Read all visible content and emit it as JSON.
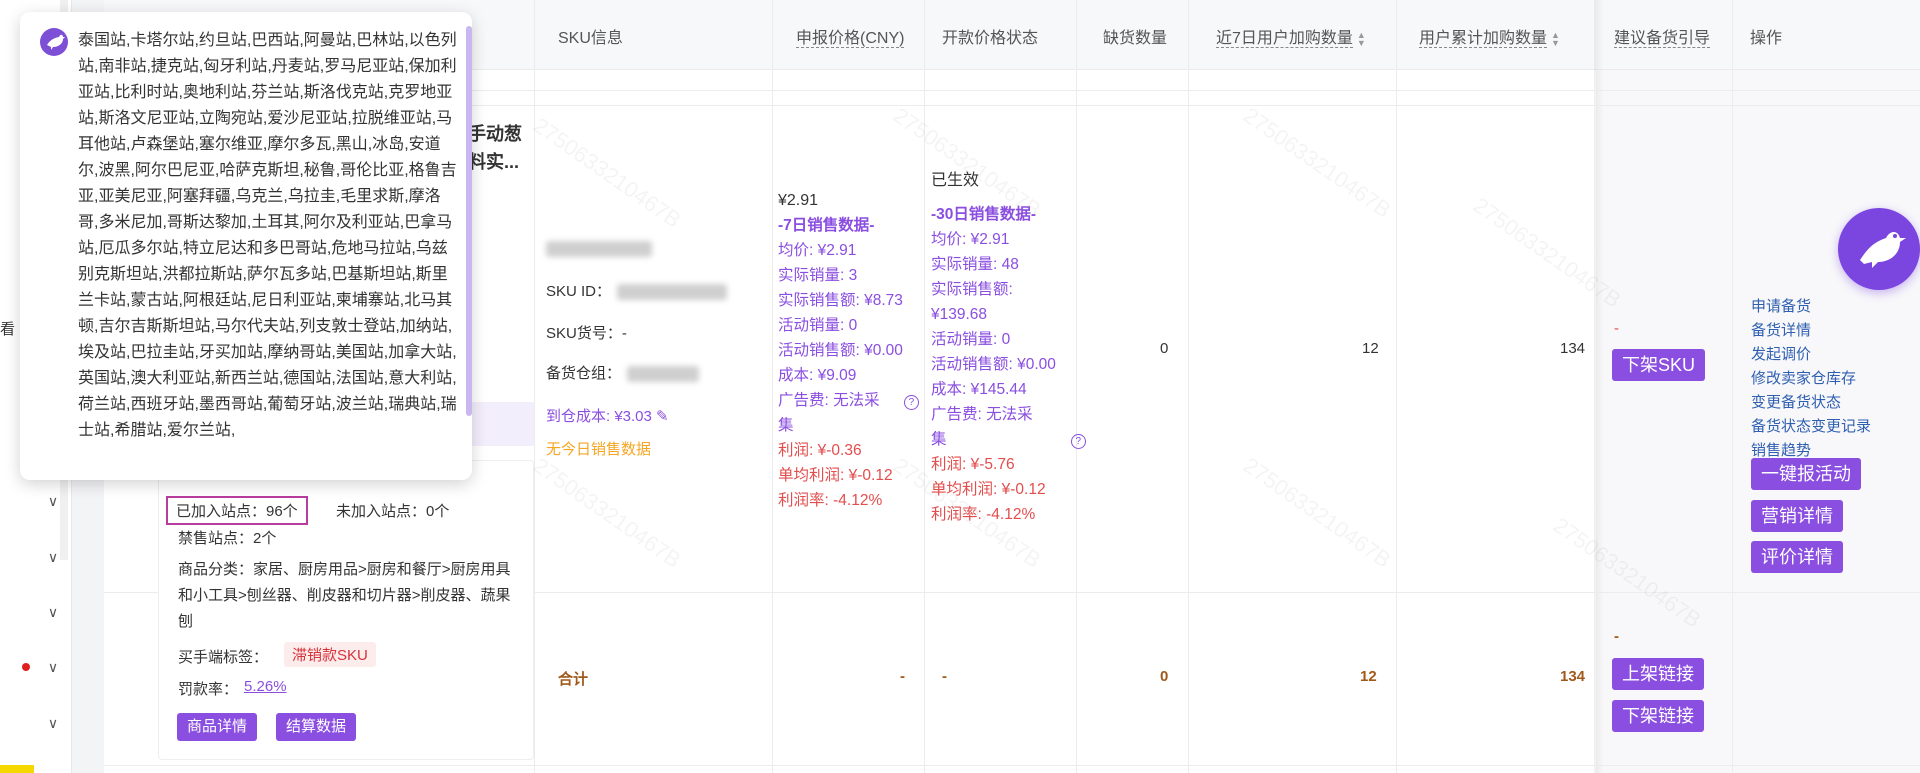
{
  "table": {
    "headers": {
      "sku_info": "SKU信息",
      "declared_price": "申报价格(CNY)",
      "open_price_status": "开款价格状态",
      "out_of_stock": "缺货数量",
      "cart_7d": "近7日用户加购数量",
      "cart_total": "用户累计加购数量",
      "stock_suggestion": "建议备货引导",
      "actions": "操作"
    }
  },
  "product": {
    "title_fragment_1": "手动葱",
    "title_fragment_2": "料实...",
    "sites_joined": "已加入站点：96个",
    "sites_not_joined": "未加入站点：0个",
    "sites_banned": "禁售站点：2个",
    "category": "商品分类：家居、厨房用品>厨房和餐厅>厨房用具和小工具>刨丝器、削皮器和切片器>削皮器、蔬果刨",
    "buyer_tag_label": "买手端标签：",
    "buyer_tag": "滞销款SKU",
    "penalty_label": "罚款率：",
    "penalty_rate": "5.26%",
    "btn_detail": "商品详情",
    "btn_settlement": "结算数据"
  },
  "sku": {
    "sku_id_label": "SKU ID：",
    "sku_code_label": "SKU货号：",
    "sku_code": "-",
    "warehouse_label": "备货仓组：",
    "warehouse_cost": "到仓成本: ¥3.03",
    "no_today_sales": "无今日销售数据"
  },
  "declared": {
    "price": "¥2.91",
    "section": "-7日销售数据-",
    "avg": "均价: ¥2.91",
    "actual_qty": "实际销量: 3",
    "actual_amount": "实际销售额: ¥8.73",
    "promo_qty": "活动销量: 0",
    "promo_amount": "活动销售额: ¥0.00",
    "cost": "成本: ¥9.09",
    "ad_fee_1": "广告费: 无法采",
    "ad_fee_2": "集",
    "profit": "利润: ¥-0.36",
    "unit_profit": "单均利润: ¥-0.12",
    "profit_rate": "利润率: -4.12%"
  },
  "open_price": {
    "status": "已生效",
    "section": "-30日销售数据-",
    "avg": "均价: ¥2.91",
    "actual_qty": "实际销量: 48",
    "actual_amount_label": "实际销售额:",
    "actual_amount": "¥139.68",
    "promo_qty": "活动销量: 0",
    "promo_amount": "活动销售额: ¥0.00",
    "cost": "成本: ¥145.44",
    "ad_fee_1": "广告费: 无法采",
    "ad_fee_2": "集",
    "profit": "利润: ¥-5.76",
    "unit_profit": "单均利润: ¥-0.12",
    "profit_rate": "利润率: -4.12%"
  },
  "row": {
    "out_of_stock": "0",
    "cart_7d": "12",
    "cart_total": "134",
    "suggestion": "-",
    "btn_unlist_sku": "下架SKU"
  },
  "actions": {
    "links": [
      "申请备货",
      "备货详情",
      "发起调价",
      "修改卖家仓库存",
      "变更备货状态",
      "备货状态变更记录",
      "销售趋势"
    ],
    "btn_promo": "一键报活动",
    "btn_marketing": "营销详情",
    "btn_review": "评价详情"
  },
  "total": {
    "label": "合计",
    "declared": "-",
    "open": "-",
    "out_of_stock": "0",
    "cart_7d": "12",
    "cart_total": "134",
    "suggestion": "-",
    "btn_list_link": "上架链接",
    "btn_unlist_link": "下架链接"
  },
  "left_rail": {
    "partial_text": "看"
  },
  "popover": {
    "text": "泰国站,卡塔尔站,约旦站,巴西站,阿曼站,巴林站,以色列站,南非站,捷克站,匈牙利站,丹麦站,罗马尼亚站,保加利亚站,比利时站,奥地利站,芬兰站,斯洛伐克站,克罗地亚站,斯洛文尼亚站,立陶宛站,爱沙尼亚站,拉脱维亚站,马耳他站,卢森堡站,塞尔维亚,摩尔多瓦,黑山,冰岛,安道尔,波黑,阿尔巴尼亚,哈萨克斯坦,秘鲁,哥伦比亚,格鲁吉亚,亚美尼亚,阿塞拜疆,乌克兰,乌拉圭,毛里求斯,摩洛哥,多米尼加,哥斯达黎加,土耳其,阿尔及利亚站,巴拿马站,厄瓜多尔站,特立尼达和多巴哥站,危地马拉站,乌兹别克斯坦站,洪都拉斯站,萨尔瓦多站,巴基斯坦站,斯里兰卡站,蒙古站,阿根廷站,尼日利亚站,柬埔寨站,北马其顿,吉尔吉斯斯坦站,马尔代夫站,列支敦士登站,加纳站,埃及站,巴拉圭站,牙买加站,摩纳哥站,美国站,加拿大站,英国站,澳大利亚站,新西兰站,德国站,法国站,意大利站,荷兰站,西班牙站,墨西哥站,葡萄牙站,波兰站,瑞典站,瑞士站,希腊站,爱尔兰站,"
  },
  "colors": {
    "accent": "#8a4ee0",
    "negative": "#e34d4d",
    "warning": "#f5a623",
    "link": "#2f5fb0",
    "total": "#a0591a"
  }
}
